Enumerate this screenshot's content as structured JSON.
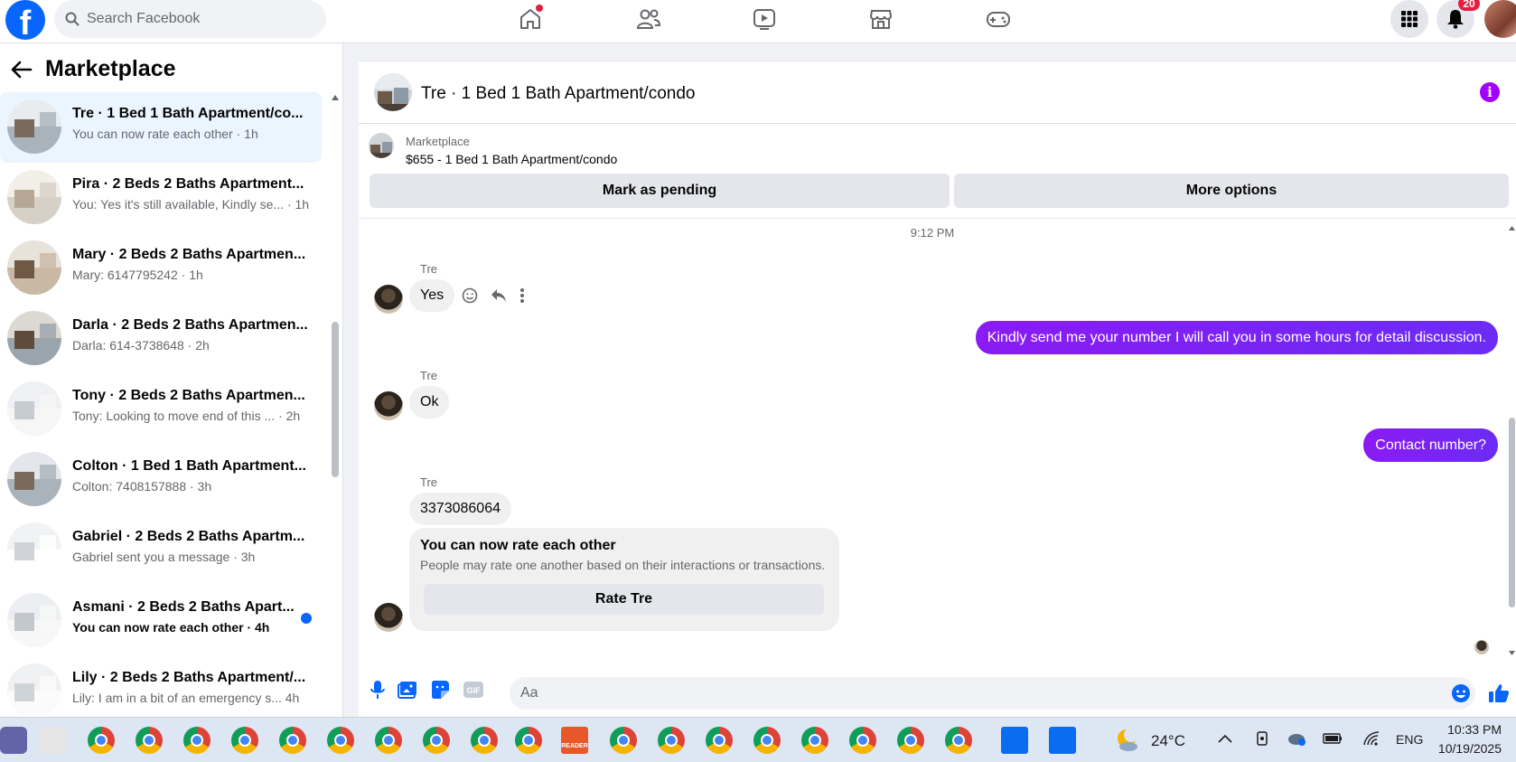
{
  "topbar": {
    "search_placeholder": "Search Facebook",
    "notifications_count": "20",
    "logo_letter": "f"
  },
  "sidebar": {
    "title": "Marketplace",
    "conversations": [
      {
        "title": "Tre · 1 Bed 1 Bath Apartment/co...",
        "preview": "You can now rate each other · 1h",
        "active": true,
        "unread": false
      },
      {
        "title": "Pira · 2 Beds 2 Baths Apartment...",
        "preview": "You: Yes it's still available, Kindly se...  · 1h",
        "active": false,
        "unread": false
      },
      {
        "title": "Mary · 2 Beds 2 Baths Apartmen...",
        "preview": "Mary: 6147795242 · 1h",
        "active": false,
        "unread": false
      },
      {
        "title": "Darla · 2 Beds 2 Baths Apartmen...",
        "preview": "Darla: 614-3738648 · 2h",
        "active": false,
        "unread": false
      },
      {
        "title": "Tony · 2 Beds 2 Baths Apartmen...",
        "preview": "Tony: Looking to move end of this ...  · 2h",
        "active": false,
        "unread": false
      },
      {
        "title": "Colton · 1 Bed 1 Bath Apartment...",
        "preview": "Colton: 7408157888 · 3h",
        "active": false,
        "unread": false
      },
      {
        "title": "Gabriel · 2 Beds 2 Baths Apartm...",
        "preview": "Gabriel sent you a message · 3h",
        "active": false,
        "unread": false
      },
      {
        "title": "Asmani · 2 Beds 2 Baths Apart...",
        "preview": "You can now rate each other · 4h",
        "active": false,
        "unread": true
      },
      {
        "title": "Lily · 2 Beds 2 Baths Apartment/...",
        "preview": "Lily: I am in a bit of an emergency s...  4h",
        "active": false,
        "unread": false
      }
    ]
  },
  "chat": {
    "title": "Tre · 1 Bed 1 Bath Apartment/condo",
    "listing": {
      "label": "Marketplace",
      "price_title": "$655 - 1 Bed 1 Bath Apartment/condo",
      "btn_pending": "Mark as pending",
      "btn_more": "More options"
    },
    "timestamp": "9:12 PM",
    "messages": {
      "sender": "Tre",
      "m1": "Yes",
      "m2_out": "Kindly send me your number I will call you in some hours for detail discussion.",
      "m3": "Ok",
      "m4_out": "Contact number?",
      "m5": "3373086064"
    },
    "rate_card": {
      "title": "You can now rate each other",
      "subtitle": "People may rate one another based on their interactions or transactions.",
      "button": "Rate Tre"
    },
    "composer_placeholder": "Aa",
    "gif_label": "GIF"
  },
  "taskbar": {
    "weather": "24°C",
    "language": "ENG",
    "time": "10:33 PM",
    "date": "10/19/2025",
    "reader_label": "READER"
  },
  "colors": {
    "accent": "#0866ff",
    "outgoing_bubble": "#7a1ff0",
    "info": "#a100ff"
  }
}
